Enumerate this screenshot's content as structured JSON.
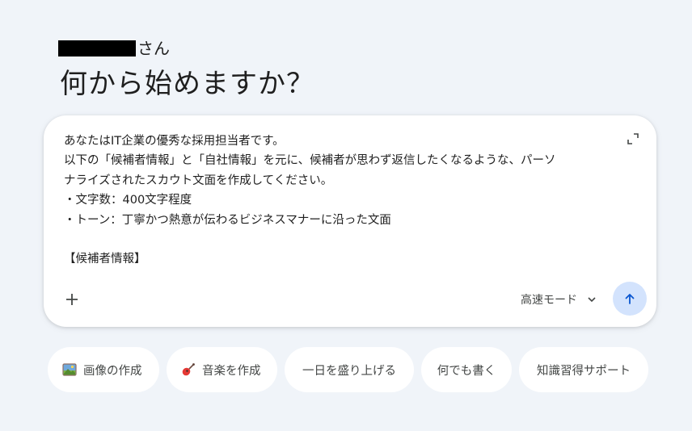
{
  "greeting": {
    "name_suffix": "さん",
    "headline": "何から始めますか？"
  },
  "prompt": {
    "lines": [
      "あなたはIT企業の優秀な採用担当者です。",
      "以下の「候補者情報」と「自社情報」を元に、候補者が思わず返信したくなるような、パーソ",
      "ナライズされたスカウト文面を作成してください。",
      "・文字数：400文字程度",
      "・トーン：丁寧かつ熱意が伝わるビジネスマナーに沿った文面",
      "",
      "【候補者情報】"
    ]
  },
  "toolbar": {
    "mode_label": "高速モード",
    "add_icon": "plus-icon",
    "send_icon": "arrow-up-icon",
    "expand_icon": "expand-icon"
  },
  "chips": [
    {
      "label": "画像の作成",
      "icon": "picture-icon"
    },
    {
      "label": "音楽を作成",
      "icon": "guitar-icon"
    },
    {
      "label": "一日を盛り上げる",
      "icon": ""
    },
    {
      "label": "何でも書く",
      "icon": ""
    },
    {
      "label": "知識習得サポート",
      "icon": ""
    }
  ],
  "colors": {
    "background": "#f0f4f9",
    "send_button": "#d3e3fd",
    "send_arrow": "#0b57d0"
  }
}
